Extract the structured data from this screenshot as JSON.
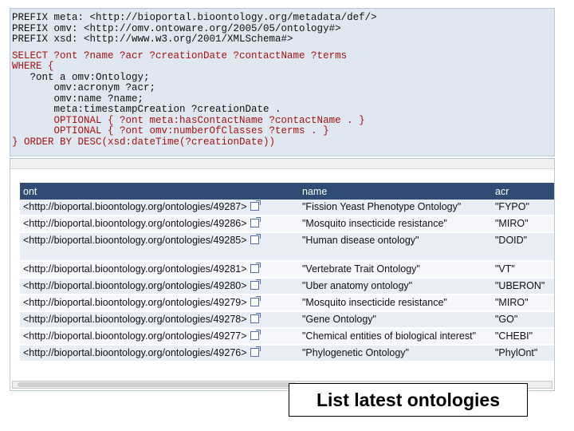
{
  "query": {
    "lines": [
      "PREFIX meta: <http://bioportal.bioontology.org/metadata/def/>",
      "PREFIX omv: <http://omv.ontoware.org/2005/05/ontology#>",
      "PREFIX xsd: <http://www.w3.org/2001/XMLSchema#>",
      "",
      "SELECT ?ont ?name ?acr ?creationDate ?contactName ?terms",
      "WHERE {",
      "   ?ont a omv:Ontology;",
      "       omv:acronym ?acr;",
      "       omv:name ?name;",
      "       meta:timestampCreation ?creationDate .",
      "       OPTIONAL { ?ont meta:hasContactName ?contactName . }",
      "       OPTIONAL { ?ont omv:numberOfClasses ?terms . }",
      "} ORDER BY DESC(xsd:dateTime(?creationDate))"
    ]
  },
  "results": {
    "columns": [
      "ont",
      "name",
      "acr"
    ],
    "rows": [
      {
        "ont": "<http://bioportal.bioontology.org/ontologies/49287>",
        "name": "\"Fission Yeast Phenotype Ontology\"",
        "acr": "\"FYPO\""
      },
      {
        "ont": "<http://bioportal.bioontology.org/ontologies/49286>",
        "name": "\"Mosquito insecticide resistance\"",
        "acr": "\"MIRO\""
      },
      {
        "ont": "<http://bioportal.bioontology.org/ontologies/49285>",
        "name": "\"Human disease ontology\"",
        "acr": "\"DOID\""
      },
      {
        "ont": "<http://bioportal.bioontology.org/ontologies/49281>",
        "name": "\"Vertebrate Trait Ontology\"",
        "acr": "\"VT\""
      },
      {
        "ont": "<http://bioportal.bioontology.org/ontologies/49280>",
        "name": "\"Uber anatomy ontology\"",
        "acr": "\"UBERON\""
      },
      {
        "ont": "<http://bioportal.bioontology.org/ontologies/49279>",
        "name": "\"Mosquito insecticide resistance\"",
        "acr": "\"MIRO\""
      },
      {
        "ont": "<http://bioportal.bioontology.org/ontologies/49278>",
        "name": "\"Gene Ontology\"",
        "acr": "\"GO\""
      },
      {
        "ont": "<http://bioportal.bioontology.org/ontologies/49277>",
        "name": "\"Chemical entities of biological interest\"",
        "acr": "\"CHEBI\""
      },
      {
        "ont": "<http://bioportal.bioontology.org/ontologies/49276>",
        "name": "\"Phylogenetic Ontology\"",
        "acr": "\"PhylOnt\""
      }
    ]
  },
  "caption": "List latest ontologies",
  "icons": {
    "external_link": "external-link-icon"
  },
  "colors": {
    "header_bg": "#2e4c74",
    "query_bg": "#dfe7f1",
    "keyword": "#a11",
    "row_alt": "#e9edf6"
  }
}
